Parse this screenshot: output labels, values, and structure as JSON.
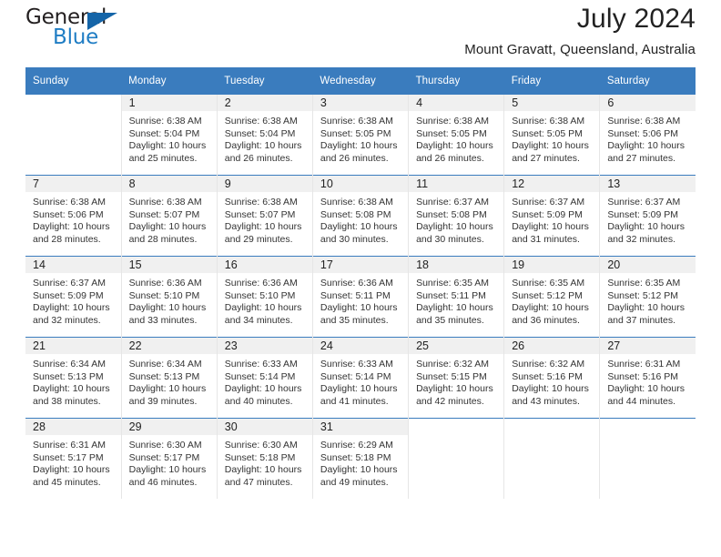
{
  "brand": {
    "name_part1": "General",
    "name_part2": "Blue",
    "triangle_icon": "triangle-icon",
    "accent_color": "#1f7dc4",
    "header_color": "#3a7cbe"
  },
  "header": {
    "title": "July 2024",
    "subtitle": "Mount Gravatt, Queensland, Australia"
  },
  "weekday_headers": [
    "Sunday",
    "Monday",
    "Tuesday",
    "Wednesday",
    "Thursday",
    "Friday",
    "Saturday"
  ],
  "labels": {
    "sunrise_prefix": "Sunrise:",
    "sunset_prefix": "Sunset:",
    "daylight_prefix": "Daylight:"
  },
  "weeks": [
    [
      {
        "day": "",
        "sunrise": "",
        "sunset": "",
        "daylight": "",
        "empty": true
      },
      {
        "day": "1",
        "sunrise": "Sunrise: 6:38 AM",
        "sunset": "Sunset: 5:04 PM",
        "daylight": "Daylight: 10 hours and 25 minutes."
      },
      {
        "day": "2",
        "sunrise": "Sunrise: 6:38 AM",
        "sunset": "Sunset: 5:04 PM",
        "daylight": "Daylight: 10 hours and 26 minutes."
      },
      {
        "day": "3",
        "sunrise": "Sunrise: 6:38 AM",
        "sunset": "Sunset: 5:05 PM",
        "daylight": "Daylight: 10 hours and 26 minutes."
      },
      {
        "day": "4",
        "sunrise": "Sunrise: 6:38 AM",
        "sunset": "Sunset: 5:05 PM",
        "daylight": "Daylight: 10 hours and 26 minutes."
      },
      {
        "day": "5",
        "sunrise": "Sunrise: 6:38 AM",
        "sunset": "Sunset: 5:05 PM",
        "daylight": "Daylight: 10 hours and 27 minutes."
      },
      {
        "day": "6",
        "sunrise": "Sunrise: 6:38 AM",
        "sunset": "Sunset: 5:06 PM",
        "daylight": "Daylight: 10 hours and 27 minutes."
      }
    ],
    [
      {
        "day": "7",
        "sunrise": "Sunrise: 6:38 AM",
        "sunset": "Sunset: 5:06 PM",
        "daylight": "Daylight: 10 hours and 28 minutes."
      },
      {
        "day": "8",
        "sunrise": "Sunrise: 6:38 AM",
        "sunset": "Sunset: 5:07 PM",
        "daylight": "Daylight: 10 hours and 28 minutes."
      },
      {
        "day": "9",
        "sunrise": "Sunrise: 6:38 AM",
        "sunset": "Sunset: 5:07 PM",
        "daylight": "Daylight: 10 hours and 29 minutes."
      },
      {
        "day": "10",
        "sunrise": "Sunrise: 6:38 AM",
        "sunset": "Sunset: 5:08 PM",
        "daylight": "Daylight: 10 hours and 30 minutes."
      },
      {
        "day": "11",
        "sunrise": "Sunrise: 6:37 AM",
        "sunset": "Sunset: 5:08 PM",
        "daylight": "Daylight: 10 hours and 30 minutes."
      },
      {
        "day": "12",
        "sunrise": "Sunrise: 6:37 AM",
        "sunset": "Sunset: 5:09 PM",
        "daylight": "Daylight: 10 hours and 31 minutes."
      },
      {
        "day": "13",
        "sunrise": "Sunrise: 6:37 AM",
        "sunset": "Sunset: 5:09 PM",
        "daylight": "Daylight: 10 hours and 32 minutes."
      }
    ],
    [
      {
        "day": "14",
        "sunrise": "Sunrise: 6:37 AM",
        "sunset": "Sunset: 5:09 PM",
        "daylight": "Daylight: 10 hours and 32 minutes."
      },
      {
        "day": "15",
        "sunrise": "Sunrise: 6:36 AM",
        "sunset": "Sunset: 5:10 PM",
        "daylight": "Daylight: 10 hours and 33 minutes."
      },
      {
        "day": "16",
        "sunrise": "Sunrise: 6:36 AM",
        "sunset": "Sunset: 5:10 PM",
        "daylight": "Daylight: 10 hours and 34 minutes."
      },
      {
        "day": "17",
        "sunrise": "Sunrise: 6:36 AM",
        "sunset": "Sunset: 5:11 PM",
        "daylight": "Daylight: 10 hours and 35 minutes."
      },
      {
        "day": "18",
        "sunrise": "Sunrise: 6:35 AM",
        "sunset": "Sunset: 5:11 PM",
        "daylight": "Daylight: 10 hours and 35 minutes."
      },
      {
        "day": "19",
        "sunrise": "Sunrise: 6:35 AM",
        "sunset": "Sunset: 5:12 PM",
        "daylight": "Daylight: 10 hours and 36 minutes."
      },
      {
        "day": "20",
        "sunrise": "Sunrise: 6:35 AM",
        "sunset": "Sunset: 5:12 PM",
        "daylight": "Daylight: 10 hours and 37 minutes."
      }
    ],
    [
      {
        "day": "21",
        "sunrise": "Sunrise: 6:34 AM",
        "sunset": "Sunset: 5:13 PM",
        "daylight": "Daylight: 10 hours and 38 minutes."
      },
      {
        "day": "22",
        "sunrise": "Sunrise: 6:34 AM",
        "sunset": "Sunset: 5:13 PM",
        "daylight": "Daylight: 10 hours and 39 minutes."
      },
      {
        "day": "23",
        "sunrise": "Sunrise: 6:33 AM",
        "sunset": "Sunset: 5:14 PM",
        "daylight": "Daylight: 10 hours and 40 minutes."
      },
      {
        "day": "24",
        "sunrise": "Sunrise: 6:33 AM",
        "sunset": "Sunset: 5:14 PM",
        "daylight": "Daylight: 10 hours and 41 minutes."
      },
      {
        "day": "25",
        "sunrise": "Sunrise: 6:32 AM",
        "sunset": "Sunset: 5:15 PM",
        "daylight": "Daylight: 10 hours and 42 minutes."
      },
      {
        "day": "26",
        "sunrise": "Sunrise: 6:32 AM",
        "sunset": "Sunset: 5:16 PM",
        "daylight": "Daylight: 10 hours and 43 minutes."
      },
      {
        "day": "27",
        "sunrise": "Sunrise: 6:31 AM",
        "sunset": "Sunset: 5:16 PM",
        "daylight": "Daylight: 10 hours and 44 minutes."
      }
    ],
    [
      {
        "day": "28",
        "sunrise": "Sunrise: 6:31 AM",
        "sunset": "Sunset: 5:17 PM",
        "daylight": "Daylight: 10 hours and 45 minutes."
      },
      {
        "day": "29",
        "sunrise": "Sunrise: 6:30 AM",
        "sunset": "Sunset: 5:17 PM",
        "daylight": "Daylight: 10 hours and 46 minutes."
      },
      {
        "day": "30",
        "sunrise": "Sunrise: 6:30 AM",
        "sunset": "Sunset: 5:18 PM",
        "daylight": "Daylight: 10 hours and 47 minutes."
      },
      {
        "day": "31",
        "sunrise": "Sunrise: 6:29 AM",
        "sunset": "Sunset: 5:18 PM",
        "daylight": "Daylight: 10 hours and 49 minutes."
      },
      {
        "day": "",
        "sunrise": "",
        "sunset": "",
        "daylight": "",
        "empty": true
      },
      {
        "day": "",
        "sunrise": "",
        "sunset": "",
        "daylight": "",
        "empty": true
      },
      {
        "day": "",
        "sunrise": "",
        "sunset": "",
        "daylight": "",
        "empty": true
      }
    ]
  ]
}
